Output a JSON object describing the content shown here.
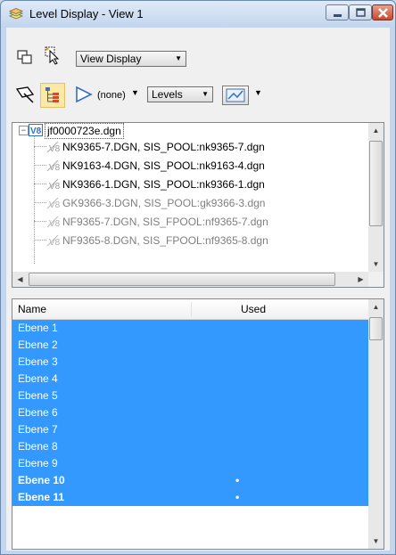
{
  "window": {
    "title": "Level Display - View 1"
  },
  "toolbar1": {
    "view_display_dropdown": "View Display"
  },
  "toolbar2": {
    "filter_label": "(none)",
    "levels_dropdown": "Levels"
  },
  "tree": {
    "root": "jf0000723e.dgn",
    "children": [
      {
        "label": "NK9365-7.DGN, SIS_POOL:nk9365-7.dgn",
        "active": true
      },
      {
        "label": "NK9163-4.DGN, SIS_POOL:nk9163-4.dgn",
        "active": true
      },
      {
        "label": "NK9366-1.DGN, SIS_POOL:nk9366-1.dgn",
        "active": true
      },
      {
        "label": "GK9366-3.DGN, SIS_POOL:gk9366-3.dgn",
        "active": false
      },
      {
        "label": "NF9365-7.DGN, SIS_FPOOL:nf9365-7.dgn",
        "active": false
      },
      {
        "label": "NF9365-8.DGN, SIS_FPOOL:nf9365-8.dgn",
        "active": false
      }
    ]
  },
  "levels_table": {
    "headers": {
      "name": "Name",
      "used": "Used"
    },
    "rows": [
      {
        "name": "Ebene 1",
        "used": "",
        "bold": false
      },
      {
        "name": "Ebene 2",
        "used": "",
        "bold": false
      },
      {
        "name": "Ebene 3",
        "used": "",
        "bold": false
      },
      {
        "name": "Ebene 4",
        "used": "",
        "bold": false
      },
      {
        "name": "Ebene 5",
        "used": "",
        "bold": false
      },
      {
        "name": "Ebene 6",
        "used": "",
        "bold": false
      },
      {
        "name": "Ebene 7",
        "used": "",
        "bold": false
      },
      {
        "name": "Ebene 8",
        "used": "",
        "bold": false
      },
      {
        "name": "Ebene 9",
        "used": "",
        "bold": false
      },
      {
        "name": "Ebene 10",
        "used": "•",
        "bold": true
      },
      {
        "name": "Ebene 11",
        "used": "•",
        "bold": true
      }
    ]
  },
  "colors": {
    "selection": "#3399ff",
    "inactive_text": "#7f7f7f",
    "title_bg": "#c2d5ee"
  }
}
